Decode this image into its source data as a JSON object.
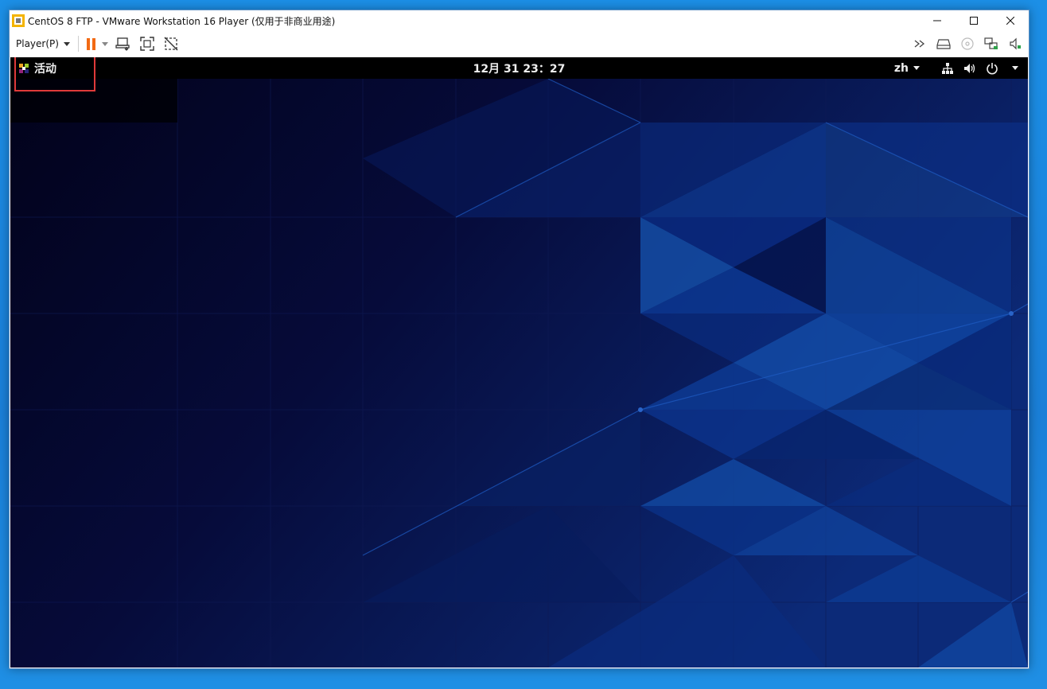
{
  "window": {
    "title": "CentOS 8 FTP - VMware Workstation 16 Player (仅用于非商业用途)",
    "controls": [
      "minimize",
      "maximize",
      "close"
    ]
  },
  "toolbar": {
    "player_menu_label": "Player(P)",
    "left_icons": [
      "pause-icon",
      "send-ctrl-alt-del-icon",
      "fullscreen-icon",
      "unity-icon"
    ],
    "right_icons": [
      "more-icon",
      "hard-disk-icon",
      "cd-dvd-icon",
      "network-adapter-icon",
      "sound-card-icon"
    ],
    "pause_color": "#f26a14"
  },
  "guest": {
    "activities_label": "活动",
    "clock": "12月 31  23：27",
    "language": "zh",
    "tray_icons": [
      "network-wired-icon",
      "volume-icon",
      "power-icon"
    ],
    "wallpaper_colors": [
      "#02021a",
      "#0a2a6e",
      "#1a4fa8"
    ],
    "highlight_color": "#e03a3a"
  }
}
